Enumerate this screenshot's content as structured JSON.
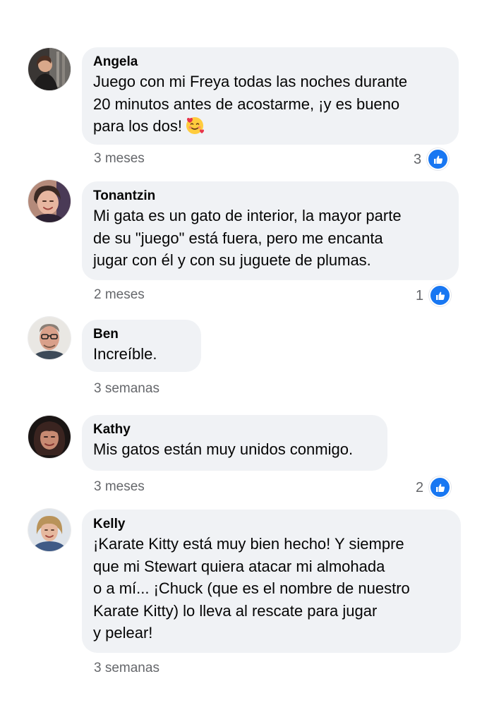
{
  "colors": {
    "bubble_bg": "#f0f2f5",
    "meta_text": "#65676b",
    "like_blue": "#1877f2"
  },
  "comments": [
    {
      "author": "Angela",
      "text": "Juego con mi Freya todas las noches durante\n20 minutos antes de acostarme, ¡y es bueno\npara los dos!",
      "emoji": "smiling-face-with-hearts",
      "time": "3 meses",
      "likes": "3"
    },
    {
      "author": "Tonantzin",
      "text": "Mi gata es un gato de interior, la mayor parte\nde su \"juego\" está fuera, pero me encanta\njugar con él y con su juguete de plumas.",
      "time": "2 meses",
      "likes": "1"
    },
    {
      "author": "Ben",
      "text": "Increíble.",
      "time": "3 semanas"
    },
    {
      "author": "Kathy",
      "text": "Mis gatos están muy unidos conmigo.",
      "time": "3 meses",
      "likes": "2"
    },
    {
      "author": "Kelly",
      "text": "¡Karate Kitty está muy bien hecho! Y siempre\nque mi Stewart quiera atacar mi almohada\no a mí... ¡Chuck (que es el nombre de nuestro\nKarate Kitty) lo lleva al rescate para jugar\ny pelear!",
      "time": "3 semanas"
    }
  ]
}
